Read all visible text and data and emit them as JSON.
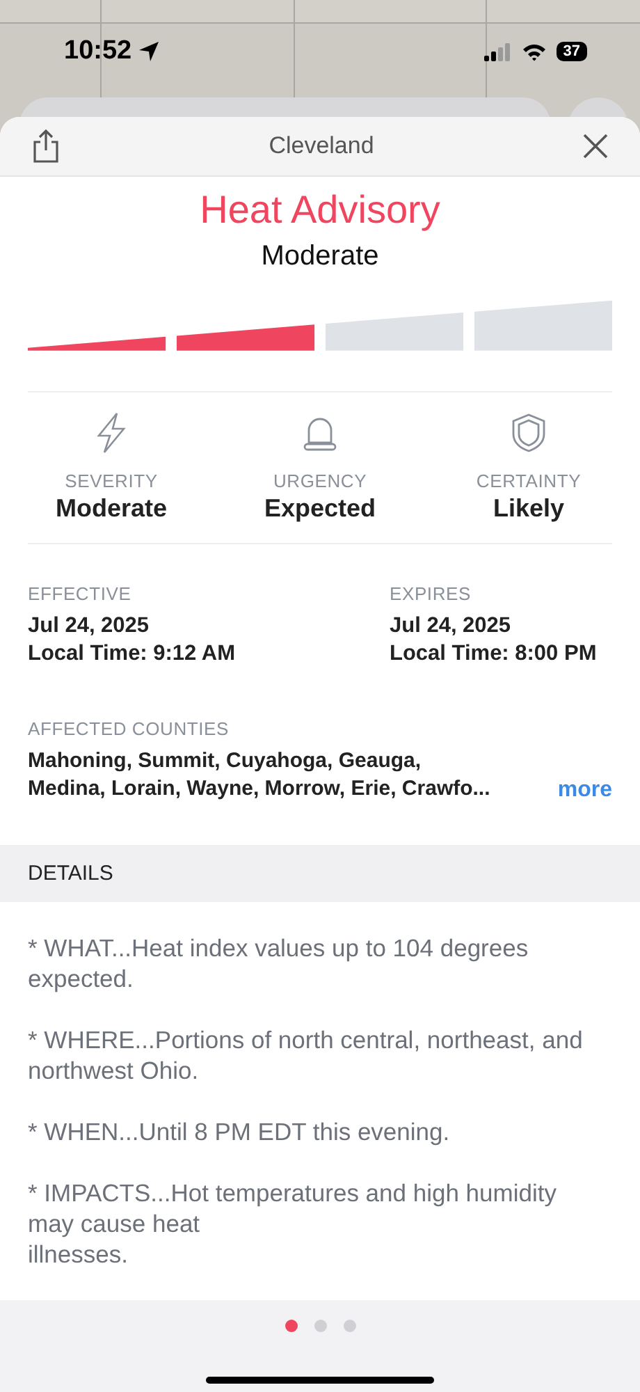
{
  "status_bar": {
    "time": "10:52",
    "battery": "37"
  },
  "header": {
    "title": "Cleveland"
  },
  "alert": {
    "title": "Heat Advisory",
    "severity": "Moderate"
  },
  "severity_meter": {
    "segments": [
      {
        "filled": true
      },
      {
        "filled": true
      },
      {
        "filled": false
      },
      {
        "filled": false
      }
    ]
  },
  "facts": [
    {
      "kind": "severity",
      "label": "SEVERITY",
      "value": "Moderate"
    },
    {
      "kind": "urgency",
      "label": "URGENCY",
      "value": "Expected"
    },
    {
      "kind": "certainty",
      "label": "CERTAINTY",
      "value": "Likely"
    }
  ],
  "times": [
    {
      "label": "EFFECTIVE",
      "date": "Jul 24, 2025",
      "time": "Local Time: 9:12 AM"
    },
    {
      "label": "EXPIRES",
      "date": "Jul 24, 2025",
      "time": "Local Time: 8:00 PM"
    }
  ],
  "counties": {
    "label": "AFFECTED COUNTIES",
    "text": "Mahoning, Summit, Cuyahoga, Geauga, Medina, Lorain, Wayne, Morrow, Erie, Crawfo...",
    "link": "more"
  },
  "details": {
    "heading": "DETAILS",
    "paragraphs": [
      "* WHAT...Heat index values up to 104 degrees expected.",
      "* WHERE...Portions of north central, northeast, and northwest Ohio.",
      "* WHEN...Until 8 PM EDT this evening.",
      "* IMPACTS...Hot temperatures and high humidity may cause heat\nillnesses."
    ]
  },
  "pages": [
    {
      "selected": true
    },
    {
      "selected": false
    },
    {
      "selected": false
    }
  ]
}
